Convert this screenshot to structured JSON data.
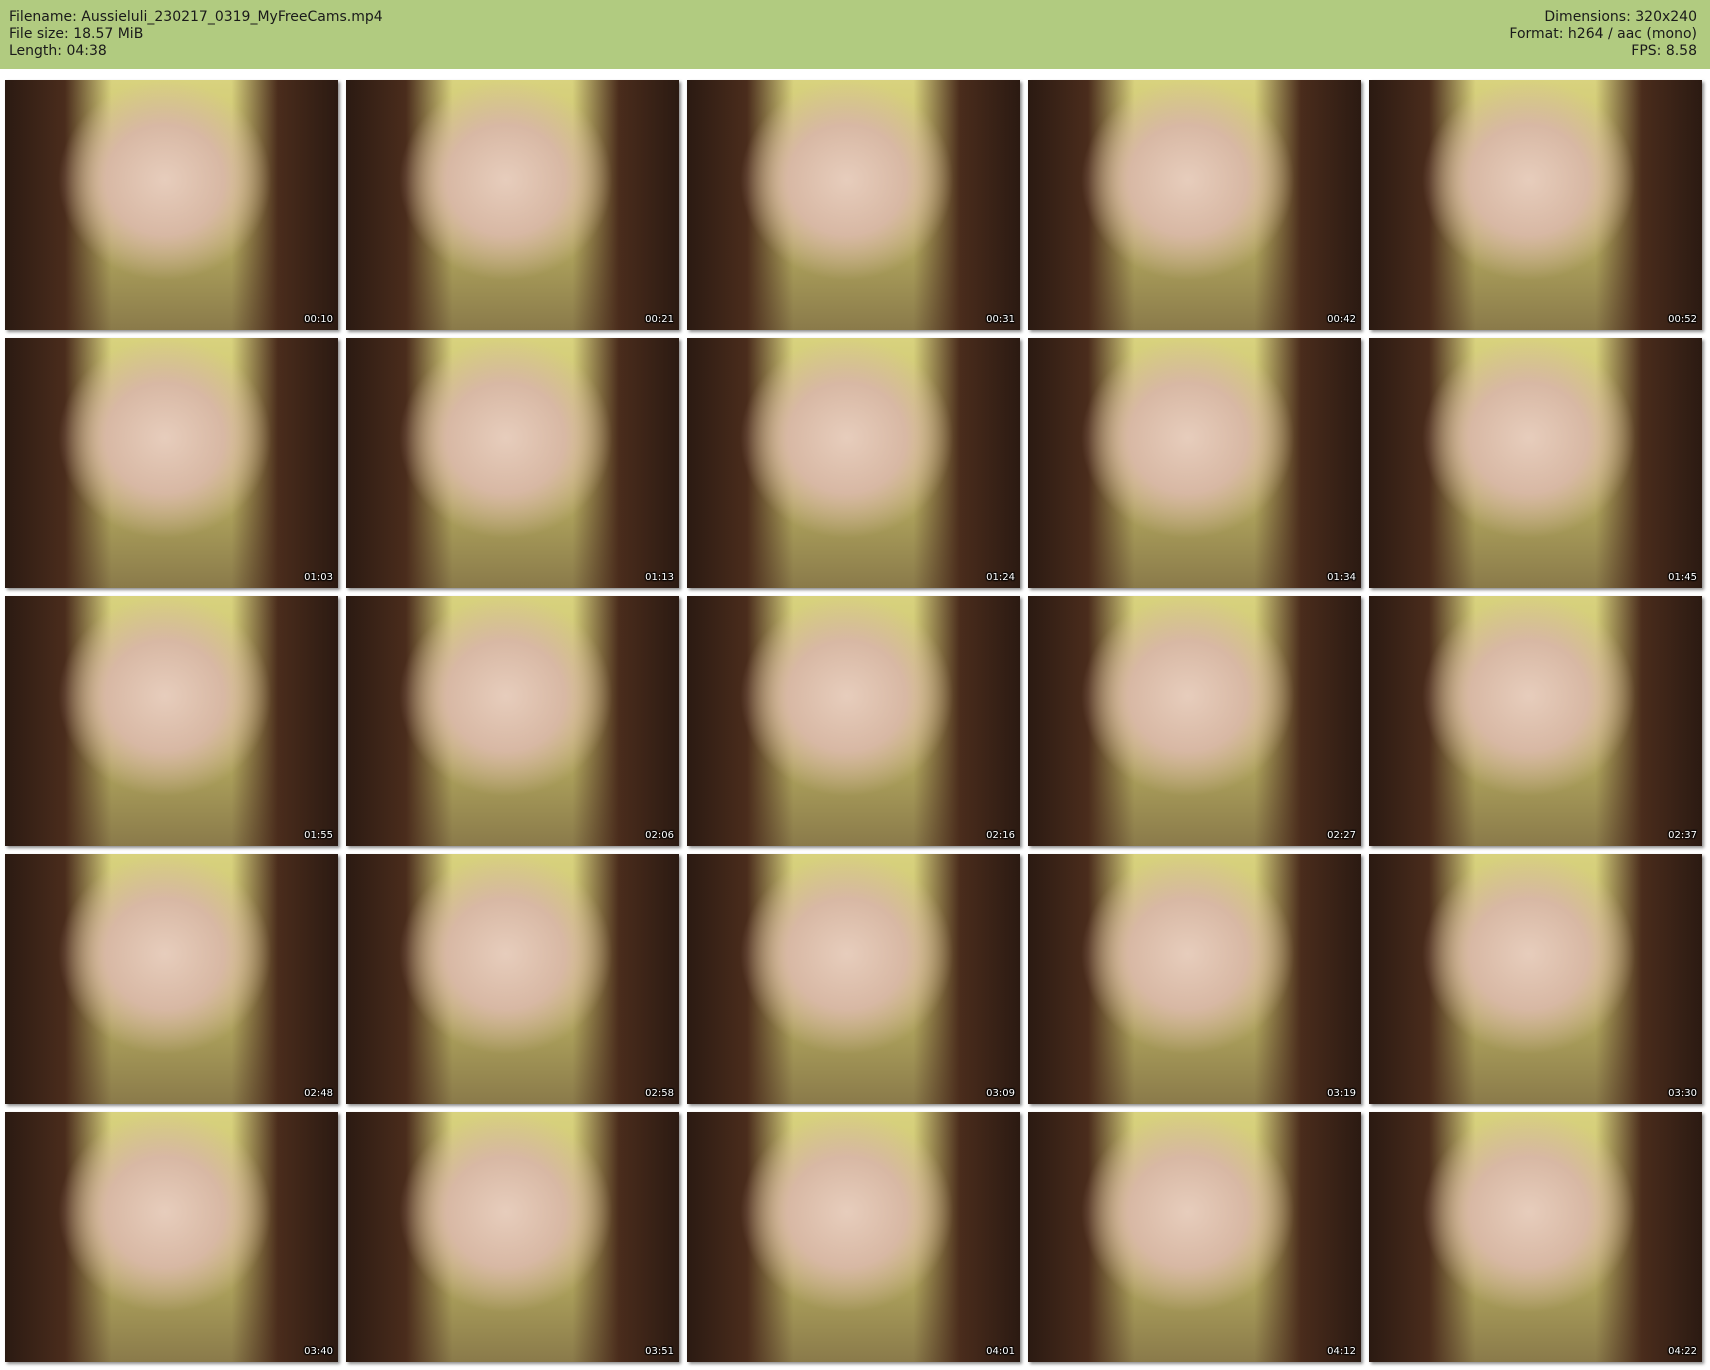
{
  "header": {
    "filename": "Filename: Aussieluli_230217_0319_MyFreeCams.mp4",
    "filesize": "File size: 18.57 MiB",
    "length": "Length: 04:38",
    "dimensions": "Dimensions: 320x240",
    "format": "Format: h264 / aac (mono)",
    "fps": "FPS: 8.58"
  },
  "thumbnails": [
    {
      "timestamp": "00:10"
    },
    {
      "timestamp": "00:21"
    },
    {
      "timestamp": "00:31"
    },
    {
      "timestamp": "00:42"
    },
    {
      "timestamp": "00:52"
    },
    {
      "timestamp": "01:03"
    },
    {
      "timestamp": "01:13"
    },
    {
      "timestamp": "01:24"
    },
    {
      "timestamp": "01:34"
    },
    {
      "timestamp": "01:45"
    },
    {
      "timestamp": "01:55"
    },
    {
      "timestamp": "02:06"
    },
    {
      "timestamp": "02:16"
    },
    {
      "timestamp": "02:27"
    },
    {
      "timestamp": "02:37"
    },
    {
      "timestamp": "02:48"
    },
    {
      "timestamp": "02:58"
    },
    {
      "timestamp": "03:09"
    },
    {
      "timestamp": "03:19"
    },
    {
      "timestamp": "03:30"
    },
    {
      "timestamp": "03:40"
    },
    {
      "timestamp": "03:51"
    },
    {
      "timestamp": "04:01"
    },
    {
      "timestamp": "04:12"
    },
    {
      "timestamp": "04:22"
    }
  ]
}
